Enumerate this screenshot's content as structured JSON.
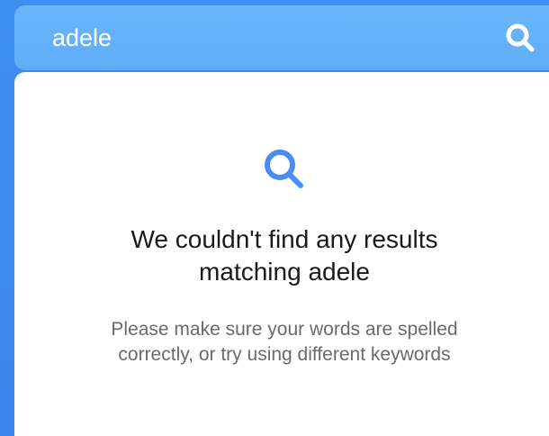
{
  "search": {
    "value": "adele",
    "button_icon": "search-icon"
  },
  "empty_state": {
    "icon": "magnifier-icon",
    "headline_lines": [
      "We couldn't find any results",
      "matching adele"
    ],
    "subtext_lines": [
      "Please make sure your words are spelled",
      "correctly, or try using different keywords"
    ]
  },
  "colors": {
    "background": "#3b86ee",
    "search_bar": "#63b0f9",
    "panel": "#ffffff",
    "icon_accent": "#4a8df0",
    "headline": "#1a1a1a",
    "subtext": "#6a6a6a"
  }
}
